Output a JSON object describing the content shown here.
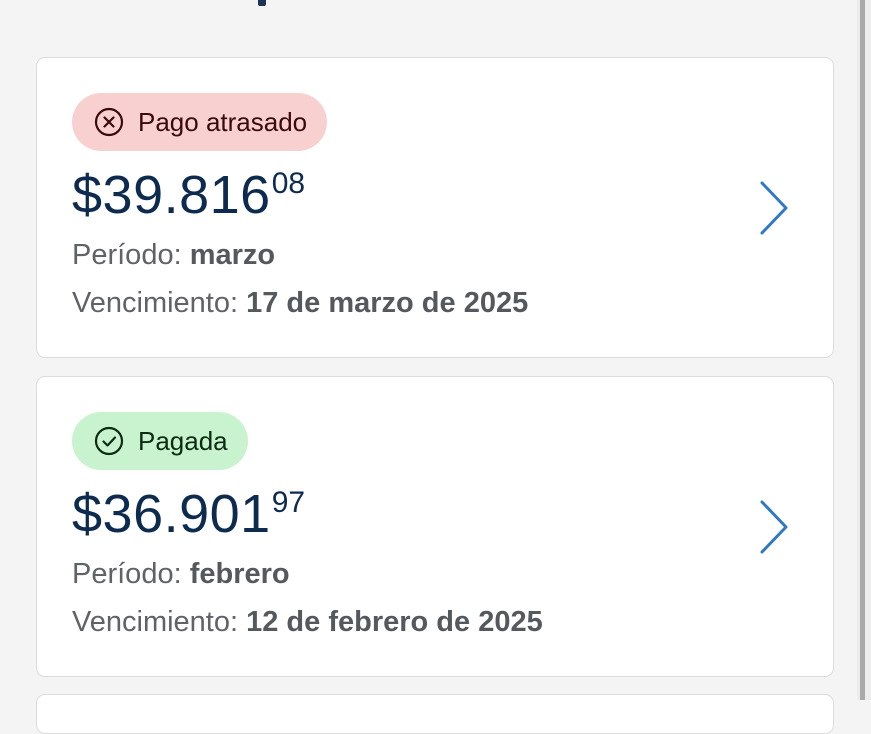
{
  "bills": [
    {
      "status": "Pago atrasado",
      "status_icon": "close-circle-icon",
      "amount_main": "$39.816",
      "amount_cents": "08",
      "period_label": "Período:",
      "period_value": "marzo",
      "due_label": "Vencimiento:",
      "due_value": "17 de marzo de 2025"
    },
    {
      "status": "Pagada",
      "status_icon": "check-circle-icon",
      "amount_main": "$36.901",
      "amount_cents": "97",
      "period_label": "Período:",
      "period_value": "febrero",
      "due_label": "Vencimiento:",
      "due_value": "12 de febrero de 2025"
    }
  ],
  "colors": {
    "overdue_badge_bg": "#f9d0d0",
    "paid_badge_bg": "#c9f2cf",
    "amount_text": "#0d2a4f",
    "chevron": "#2f79c4"
  }
}
